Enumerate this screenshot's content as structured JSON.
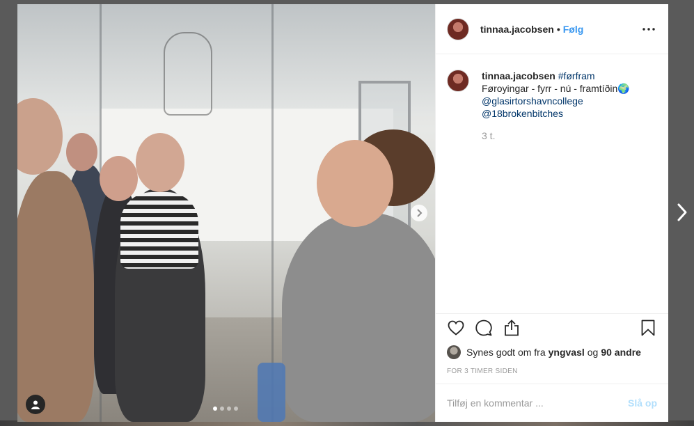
{
  "post": {
    "username": "tinnaa.jacobsen",
    "separator": "•",
    "follow_label": "Følg",
    "caption": {
      "username": "tinnaa.jacobsen",
      "hashtag": "#førfram",
      "text": "Føroyingar - fyrr - nú - framtíðin🌍",
      "mention1": "@glasirtorshavncollege",
      "mention2": "@18brokenbitches",
      "time": "3 t."
    },
    "likes": {
      "prefix": "Synes godt om fra",
      "liker": "yngvasl",
      "conjunction": "og",
      "others": "90 andre"
    },
    "timestamp": "FOR 3 TIMER SIDEN",
    "comment": {
      "placeholder": "Tilføj en kommentar ...",
      "post_label": "Slå op"
    },
    "carousel": {
      "total": 4,
      "active": 1
    }
  },
  "icons": {
    "more": "more-horizontal-icon",
    "like": "heart-icon",
    "comment": "comment-bubble-icon",
    "share": "share-icon",
    "save": "bookmark-icon",
    "user_tag": "user-icon",
    "next_photo": "chevron-right-icon",
    "next_post": "chevron-right-icon"
  },
  "colors": {
    "link": "#003569",
    "follow": "#3897f0",
    "post_disabled": "#b2dffc",
    "muted": "#999999",
    "text": "#262626"
  }
}
